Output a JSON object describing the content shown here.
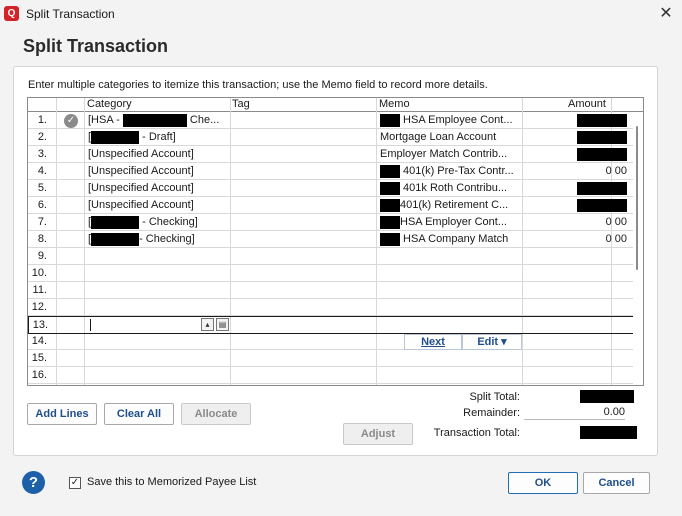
{
  "window": {
    "title": "Split Transaction",
    "app_icon_glyph": "Q",
    "close_glyph": "✕"
  },
  "heading": "Split Transaction",
  "instruction": "Enter multiple categories to itemize this transaction; use the Memo field to record more details.",
  "columns": {
    "category": "Category",
    "tag": "Tag",
    "memo": "Memo",
    "amount": "Amount"
  },
  "rows": [
    {
      "num": "1.",
      "has_check": true,
      "category": "[HSA - ",
      "category_suffix": " Che...",
      "tag": "",
      "memo": " HSA Employee Cont...",
      "memo_redacted_prefix": true,
      "amount": "",
      "amount_redacted": true
    },
    {
      "num": "2.",
      "has_check": false,
      "category": "[",
      "category_suffix": " - Draft]",
      "tag": "",
      "memo": "Mortgage Loan Account",
      "memo_redacted_prefix": false,
      "amount": "",
      "amount_redacted": true
    },
    {
      "num": "3.",
      "has_check": false,
      "category": "[Unspecified Account]",
      "category_suffix": "",
      "tag": "",
      "memo": "Employer Match Contrib...",
      "memo_redacted_prefix": false,
      "amount": "",
      "amount_redacted": true
    },
    {
      "num": "4.",
      "has_check": false,
      "category": "[Unspecified Account]",
      "category_suffix": "",
      "tag": "",
      "memo": " 401(k) Pre-Tax Contr...",
      "memo_redacted_prefix": true,
      "amount": "0 00",
      "amount_redacted": false
    },
    {
      "num": "5.",
      "has_check": false,
      "category": "[Unspecified Account]",
      "category_suffix": "",
      "tag": "",
      "memo": " 401k Roth Contribu...",
      "memo_redacted_prefix": true,
      "amount": "",
      "amount_redacted": true
    },
    {
      "num": "6.",
      "has_check": false,
      "category": "[Unspecified Account]",
      "category_suffix": "",
      "tag": "",
      "memo": "401(k) Retirement C...",
      "memo_redacted_prefix": true,
      "amount": "",
      "amount_redacted": true
    },
    {
      "num": "7.",
      "has_check": false,
      "category": "[",
      "category_suffix": " - Checking]",
      "tag": "",
      "memo": "HSA Employer Cont...",
      "memo_redacted_prefix": true,
      "amount": "0 00",
      "amount_redacted": false
    },
    {
      "num": "8.",
      "has_check": false,
      "category": "[",
      "category_suffix": "- Checking]",
      "tag": "",
      "memo": " HSA Company Match",
      "memo_redacted_prefix": true,
      "amount": "0 00",
      "amount_redacted": false
    },
    {
      "num": "9.",
      "has_check": false,
      "category": "",
      "category_suffix": "",
      "tag": "",
      "memo": "",
      "memo_redacted_prefix": false,
      "amount": "",
      "amount_redacted": false
    },
    {
      "num": "10.",
      "has_check": false,
      "category": "",
      "category_suffix": "",
      "tag": "",
      "memo": "",
      "memo_redacted_prefix": false,
      "amount": "",
      "amount_redacted": false
    },
    {
      "num": "11.",
      "has_check": false,
      "category": "",
      "category_suffix": "",
      "tag": "",
      "memo": "",
      "memo_redacted_prefix": false,
      "amount": "",
      "amount_redacted": false
    },
    {
      "num": "12.",
      "has_check": false,
      "category": "",
      "category_suffix": "",
      "tag": "",
      "memo": "",
      "memo_redacted_prefix": false,
      "amount": "",
      "amount_redacted": false
    },
    {
      "num": "13.",
      "has_check": false,
      "category": "",
      "category_suffix": "",
      "tag": "",
      "memo": "",
      "memo_redacted_prefix": false,
      "amount": "",
      "amount_redacted": false,
      "active": true
    },
    {
      "num": "14.",
      "has_check": false,
      "category": "",
      "category_suffix": "",
      "tag": "",
      "memo": "",
      "memo_redacted_prefix": false,
      "amount": "",
      "amount_redacted": false
    },
    {
      "num": "15.",
      "has_check": false,
      "category": "",
      "category_suffix": "",
      "tag": "",
      "memo": "",
      "memo_redacted_prefix": false,
      "amount": "",
      "amount_redacted": false
    },
    {
      "num": "16.",
      "has_check": false,
      "category": "",
      "category_suffix": "",
      "tag": "",
      "memo": "",
      "memo_redacted_prefix": false,
      "amount": "",
      "amount_redacted": false
    }
  ],
  "row_buttons": {
    "next": "Next",
    "edit": "Edit ▾"
  },
  "buttons": {
    "add_lines": "Add Lines",
    "clear_all": "Clear All",
    "allocate": "Allocate",
    "adjust": "Adjust",
    "ok": "OK",
    "cancel": "Cancel"
  },
  "totals": {
    "split_total_label": "Split Total:",
    "remainder_label": "Remainder:",
    "remainder_value": "0.00",
    "transaction_total_label": "Transaction Total:"
  },
  "footer": {
    "help_glyph": "?",
    "memorize_label": "Save this to Memorized Payee List",
    "memorize_checked": true,
    "check_glyph": "✓"
  },
  "colors": {
    "accent": "#1f4e8c",
    "help_blue": "#1d5fa8",
    "brand_red": "#d2232a"
  }
}
